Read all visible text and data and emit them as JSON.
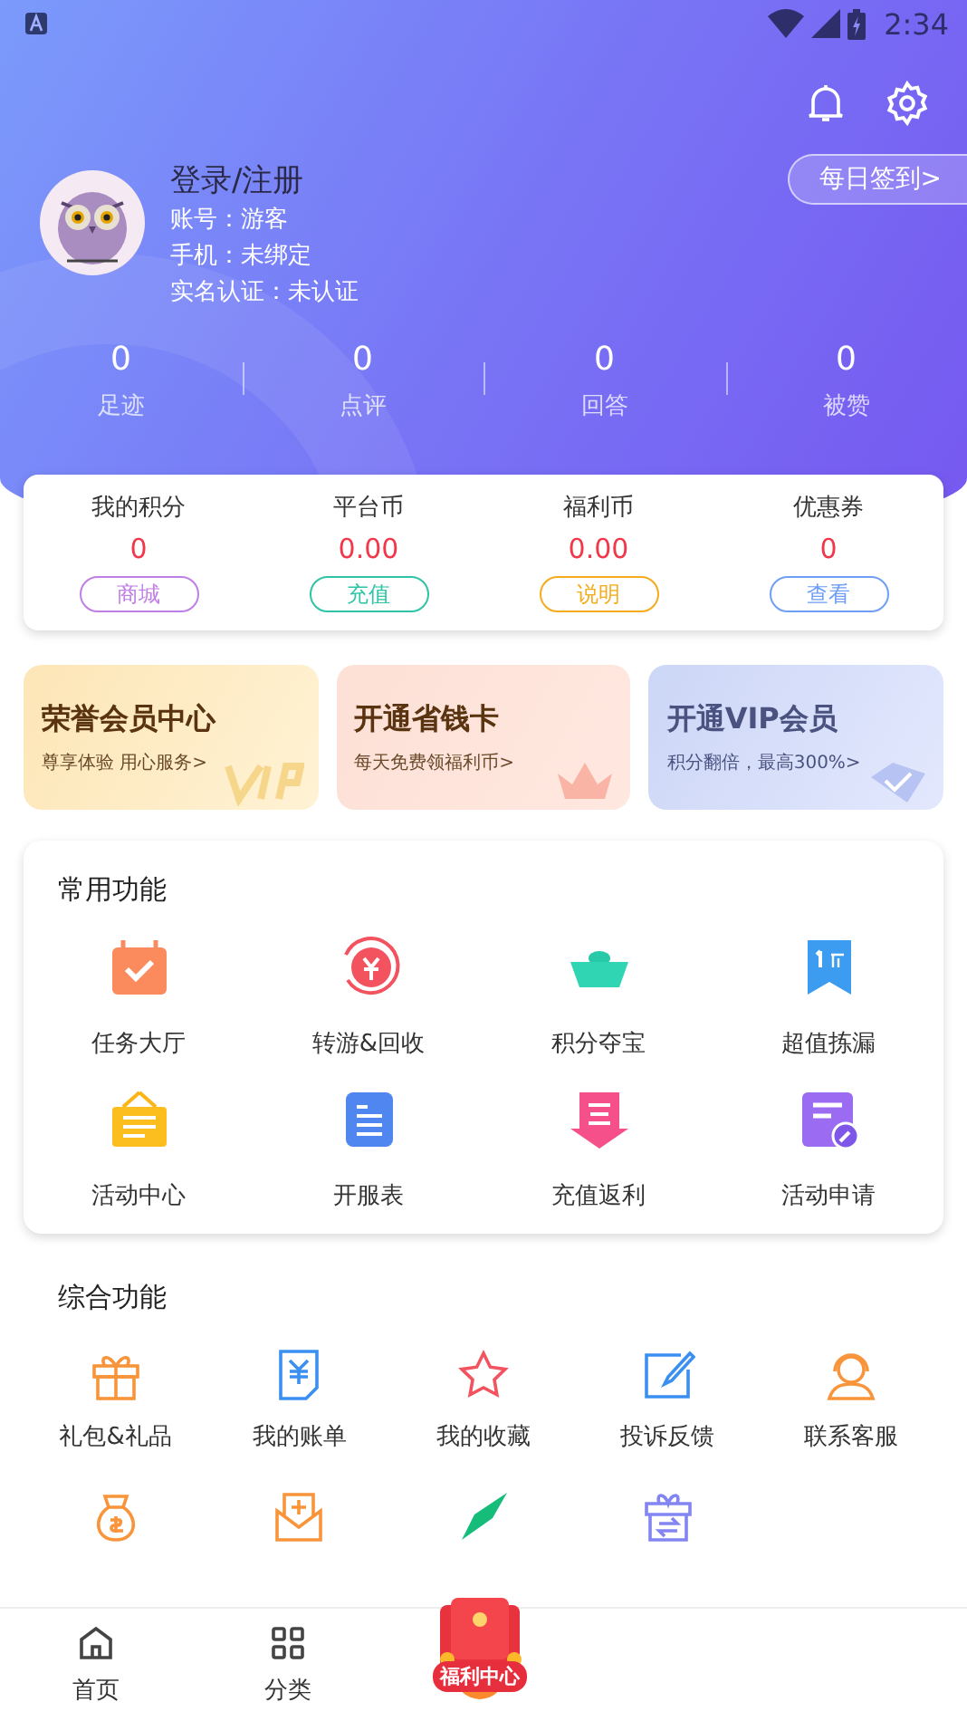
{
  "status_bar": {
    "time": "2:34"
  },
  "header": {
    "login": "登录/注册",
    "info": [
      "账号：游客",
      "手机：未绑定",
      "实名认证：未认证"
    ],
    "checkin": "每日签到>",
    "stats": [
      {
        "value": "0",
        "label": "足迹"
      },
      {
        "value": "0",
        "label": "点评"
      },
      {
        "value": "0",
        "label": "回答"
      },
      {
        "value": "0",
        "label": "被赞"
      }
    ]
  },
  "wallet": [
    {
      "label": "我的积分",
      "value": "0",
      "action": "商城",
      "color": "#c07ee6"
    },
    {
      "label": "平台币",
      "value": "0.00",
      "action": "充值",
      "color": "#2ec4a5"
    },
    {
      "label": "福利币",
      "value": "0.00",
      "action": "说明",
      "color": "#f5ab1b"
    },
    {
      "label": "优惠券",
      "value": "0",
      "action": "查看",
      "color": "#6f9ef5"
    }
  ],
  "promos": [
    {
      "kind": "gold",
      "title": "荣誉会员中心",
      "subtitle": "尊享体验 用心服务>"
    },
    {
      "kind": "coral",
      "title": "开通省钱卡",
      "subtitle": "每天免费领福利币>"
    },
    {
      "kind": "blue",
      "title": "开通VIP会员",
      "subtitle": "积分翻倍，最高300%>"
    }
  ],
  "common": {
    "title": "常用功能",
    "items": [
      {
        "label": "任务大厅"
      },
      {
        "label": "转游&回收"
      },
      {
        "label": "积分夺宝"
      },
      {
        "label": "超值拣漏"
      },
      {
        "label": "活动中心"
      },
      {
        "label": "开服表"
      },
      {
        "label": "充值返利"
      },
      {
        "label": "活动申请"
      }
    ]
  },
  "general": {
    "title": "综合功能",
    "items": [
      {
        "label": "礼包&礼品"
      },
      {
        "label": "我的账单"
      },
      {
        "label": "我的收藏"
      },
      {
        "label": "投诉反馈"
      },
      {
        "label": "联系客服"
      }
    ]
  },
  "nav": [
    {
      "kind": "tab",
      "label": "首页"
    },
    {
      "kind": "tab",
      "label": "分类"
    },
    {
      "kind": "feature",
      "label": "福利中心"
    }
  ]
}
